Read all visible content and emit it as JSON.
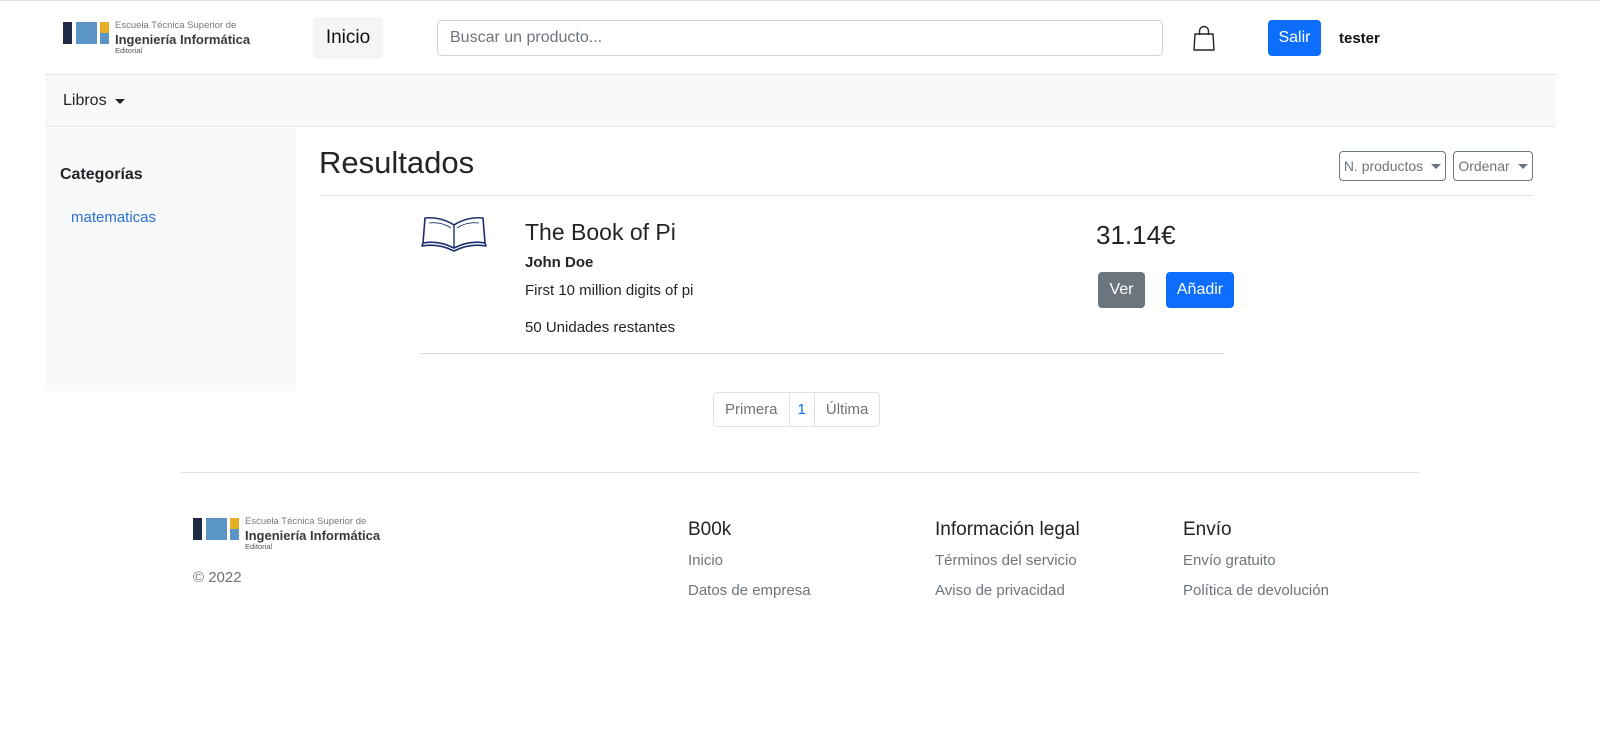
{
  "header": {
    "logo": {
      "line1": "Escuela Técnica Superior de",
      "line2": "Ingeniería Informática",
      "line3": "Editorial"
    },
    "home_label": "Inicio",
    "search": {
      "placeholder": "Buscar un producto..."
    },
    "cart_icon": "shopping-bag-icon",
    "logout_label": "Salir",
    "username": "tester"
  },
  "navbar": {
    "libros_label": "Libros"
  },
  "sidebar": {
    "title": "Categorías",
    "categories": [
      {
        "label": "matematicas"
      }
    ]
  },
  "results": {
    "title": "Resultados",
    "per_page_label": "N. productos",
    "order_label": "Ordenar",
    "items": [
      {
        "icon": "open-book-icon",
        "title": "The Book of Pi",
        "author": "John Doe",
        "description": "First 10 million digits of pi",
        "stock": "50 Unidades restantes",
        "price": "31.14€",
        "view_label": "Ver",
        "add_label": "Añadir"
      }
    ]
  },
  "pagination": {
    "first": "Primera",
    "current": "1",
    "last": "Última"
  },
  "footer": {
    "logo": {
      "line1": "Escuela Técnica Superior de",
      "line2": "Ingeniería Informática",
      "line3": "Editorial"
    },
    "copyright": "© 2022",
    "columns": [
      {
        "title": "B00k",
        "links": [
          "Inicio",
          "Datos de empresa"
        ]
      },
      {
        "title": "Información legal",
        "links": [
          "Términos del servicio",
          "Aviso de privacidad"
        ]
      },
      {
        "title": "Envío",
        "links": [
          "Envío gratuito",
          "Política de devolución"
        ]
      }
    ]
  },
  "colors": {
    "primary": "#0d6efd",
    "secondary": "#6c757d",
    "navbar_bg": "#f8f9fa",
    "link": "#2b6fd6"
  }
}
